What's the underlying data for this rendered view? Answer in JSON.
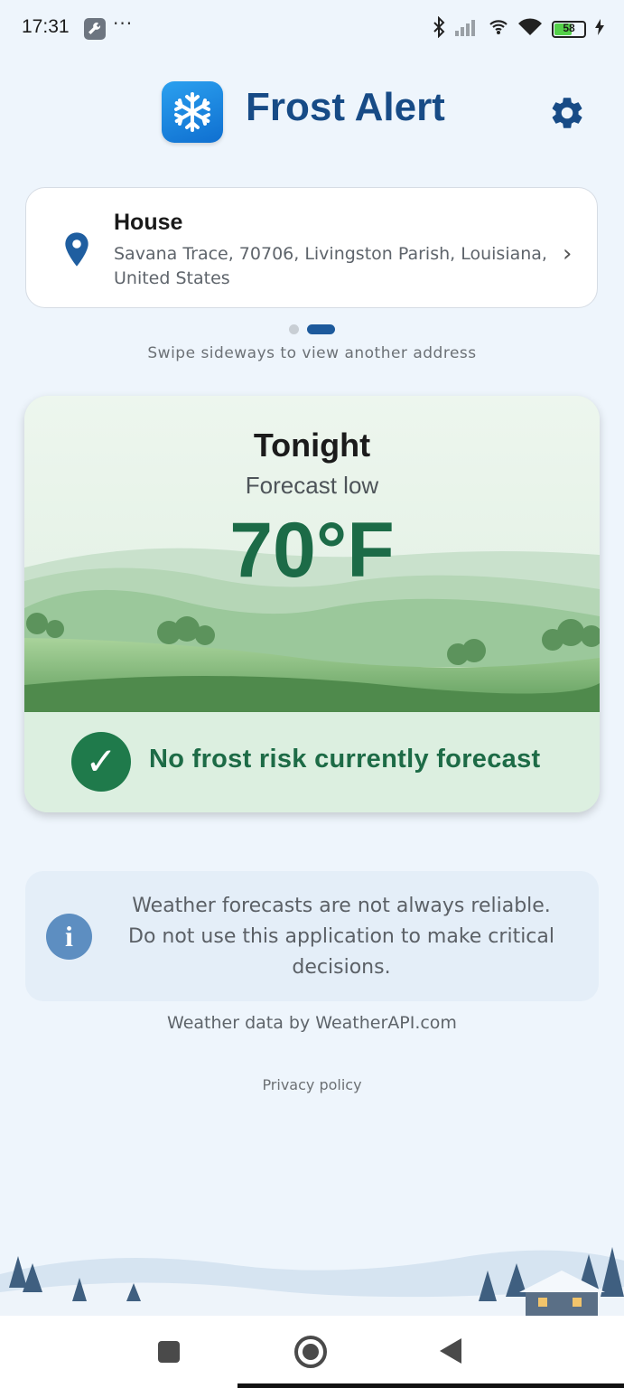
{
  "status_bar": {
    "time": "17:31",
    "overflow": "···",
    "battery_level": "58",
    "battery_fraction": 0.58,
    "icons": [
      "wrench-icon",
      "bluetooth-icon",
      "signal-icon",
      "hotspot-icon",
      "wifi-icon",
      "battery-icon",
      "charging-icon"
    ]
  },
  "header": {
    "app_title": "Frost Alert",
    "logo_icon": "snowflake-icon",
    "settings_icon": "gear-icon"
  },
  "address": {
    "name": "House",
    "line": "Savana Trace, 70706, Livingston Parish, Louisiana, United States"
  },
  "pager": {
    "pages": 2,
    "active_index": 1,
    "hint": "Swipe sideways to view another address"
  },
  "forecast": {
    "title": "Tonight",
    "subtitle": "Forecast low",
    "temperature": "70°F",
    "risk_text": "No frost risk currently forecast",
    "risk_icon": "checkmark-icon",
    "risk_color": "#1f7a4b"
  },
  "disclaimer": {
    "text": "Weather forecasts are not always reliable. Do not use this application to make critical decisions.",
    "icon": "info-icon"
  },
  "footer": {
    "attribution": "Weather data by WeatherAPI.com",
    "privacy_label": "Privacy policy"
  },
  "colors": {
    "brand": "#174b86",
    "temperature": "#1c6b47",
    "background": "#eef5fc"
  }
}
